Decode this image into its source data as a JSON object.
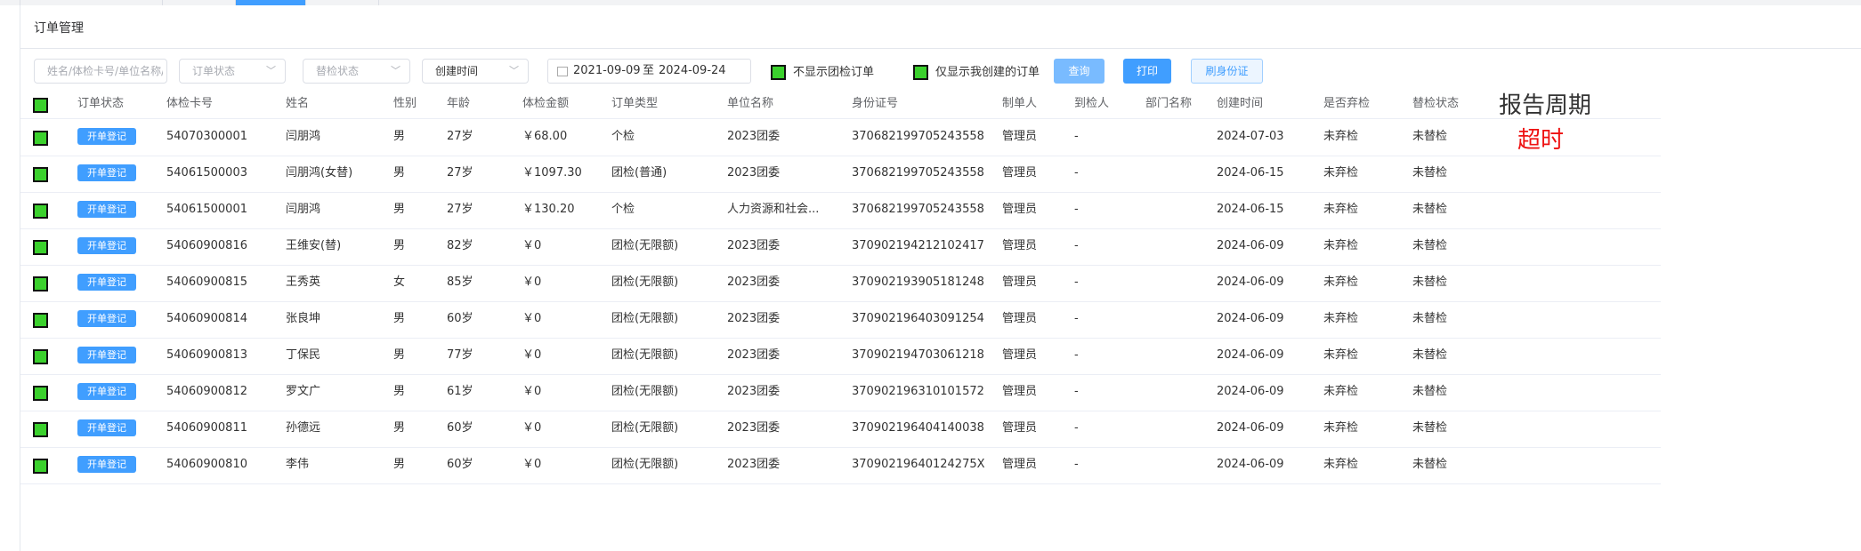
{
  "page": {
    "title": "订单管理"
  },
  "filters": {
    "name_placeholder": "姓名/体检卡号/单位名称/身份证号",
    "order_status_placeholder": "订单状态",
    "exam_status_placeholder": "替检状态",
    "time_select_value": "创建时间",
    "date_start": "2021-09-09",
    "date_sep": "至",
    "date_end": "2024-09-24",
    "hide_group_label": "不显示团检订单",
    "only_mine_label": "仅显示我创建的订单"
  },
  "buttons": {
    "query": "查询",
    "print": "打印",
    "id_card": "刷身份证"
  },
  "colors": {
    "checkbox": "#3bd12d",
    "primary": "#409eff",
    "annotation_red": "#ee1111"
  },
  "table": {
    "columns": [
      "订单状态",
      "体检卡号",
      "姓名",
      "性别",
      "年龄",
      "体检金额",
      "订单类型",
      "单位名称",
      "身份证号",
      "制单人",
      "到检人",
      "部门名称",
      "创建时间",
      "是否弃检",
      "替检状态"
    ],
    "rows": [
      {
        "status": "开单登记",
        "card": "54070300001",
        "name": "闫朋鸿",
        "gender": "男",
        "age": "27岁",
        "amount": "￥68.00",
        "type": "个检",
        "unit": "2023团委",
        "id": "370682199705243558",
        "maker": "管理员",
        "arrival": "-",
        "dept": "",
        "created": "2024-07-03",
        "abandon": "未弃检",
        "replace": "未替检"
      },
      {
        "status": "开单登记",
        "card": "54061500003",
        "name": "闫朋鸿(女替)",
        "gender": "男",
        "age": "27岁",
        "amount": "￥1097.30",
        "type": "团检(普通)",
        "unit": "2023团委",
        "id": "370682199705243558",
        "maker": "管理员",
        "arrival": "-",
        "dept": "",
        "created": "2024-06-15",
        "abandon": "未弃检",
        "replace": "未替检"
      },
      {
        "status": "开单登记",
        "card": "54061500001",
        "name": "闫朋鸿",
        "gender": "男",
        "age": "27岁",
        "amount": "￥130.20",
        "type": "个检",
        "unit": "人力资源和社会...",
        "id": "370682199705243558",
        "maker": "管理员",
        "arrival": "-",
        "dept": "",
        "created": "2024-06-15",
        "abandon": "未弃检",
        "replace": "未替检"
      },
      {
        "status": "开单登记",
        "card": "54060900816",
        "name": "王维安(替)",
        "gender": "男",
        "age": "82岁",
        "amount": "￥0",
        "type": "团检(无限额)",
        "unit": "2023团委",
        "id": "370902194212102417",
        "maker": "管理员",
        "arrival": "-",
        "dept": "",
        "created": "2024-06-09",
        "abandon": "未弃检",
        "replace": "未替检"
      },
      {
        "status": "开单登记",
        "card": "54060900815",
        "name": "王秀英",
        "gender": "女",
        "age": "85岁",
        "amount": "￥0",
        "type": "团检(无限额)",
        "unit": "2023团委",
        "id": "370902193905181248",
        "maker": "管理员",
        "arrival": "-",
        "dept": "",
        "created": "2024-06-09",
        "abandon": "未弃检",
        "replace": "未替检"
      },
      {
        "status": "开单登记",
        "card": "54060900814",
        "name": "张良坤",
        "gender": "男",
        "age": "60岁",
        "amount": "￥0",
        "type": "团检(无限额)",
        "unit": "2023团委",
        "id": "370902196403091254",
        "maker": "管理员",
        "arrival": "-",
        "dept": "",
        "created": "2024-06-09",
        "abandon": "未弃检",
        "replace": "未替检"
      },
      {
        "status": "开单登记",
        "card": "54060900813",
        "name": "丁保民",
        "gender": "男",
        "age": "77岁",
        "amount": "￥0",
        "type": "团检(无限额)",
        "unit": "2023团委",
        "id": "370902194703061218",
        "maker": "管理员",
        "arrival": "-",
        "dept": "",
        "created": "2024-06-09",
        "abandon": "未弃检",
        "replace": "未替检"
      },
      {
        "status": "开单登记",
        "card": "54060900812",
        "name": "罗文广",
        "gender": "男",
        "age": "61岁",
        "amount": "￥0",
        "type": "团检(无限额)",
        "unit": "2023团委",
        "id": "370902196310101572",
        "maker": "管理员",
        "arrival": "-",
        "dept": "",
        "created": "2024-06-09",
        "abandon": "未弃检",
        "replace": "未替检"
      },
      {
        "status": "开单登记",
        "card": "54060900811",
        "name": "孙德远",
        "gender": "男",
        "age": "60岁",
        "amount": "￥0",
        "type": "团检(无限额)",
        "unit": "2023团委",
        "id": "370902196404140038",
        "maker": "管理员",
        "arrival": "-",
        "dept": "",
        "created": "2024-06-09",
        "abandon": "未弃检",
        "replace": "未替检"
      },
      {
        "status": "开单登记",
        "card": "54060900810",
        "name": "李伟",
        "gender": "男",
        "age": "60岁",
        "amount": "￥0",
        "type": "团检(无限额)",
        "unit": "2023团委",
        "id": "370902196401242​75X",
        "maker": "管理员",
        "arrival": "-",
        "dept": "",
        "created": "2024-06-09",
        "abandon": "未弃检",
        "replace": "未替检"
      }
    ]
  },
  "annotation": {
    "title": "报告周期",
    "subtitle": "超时"
  }
}
